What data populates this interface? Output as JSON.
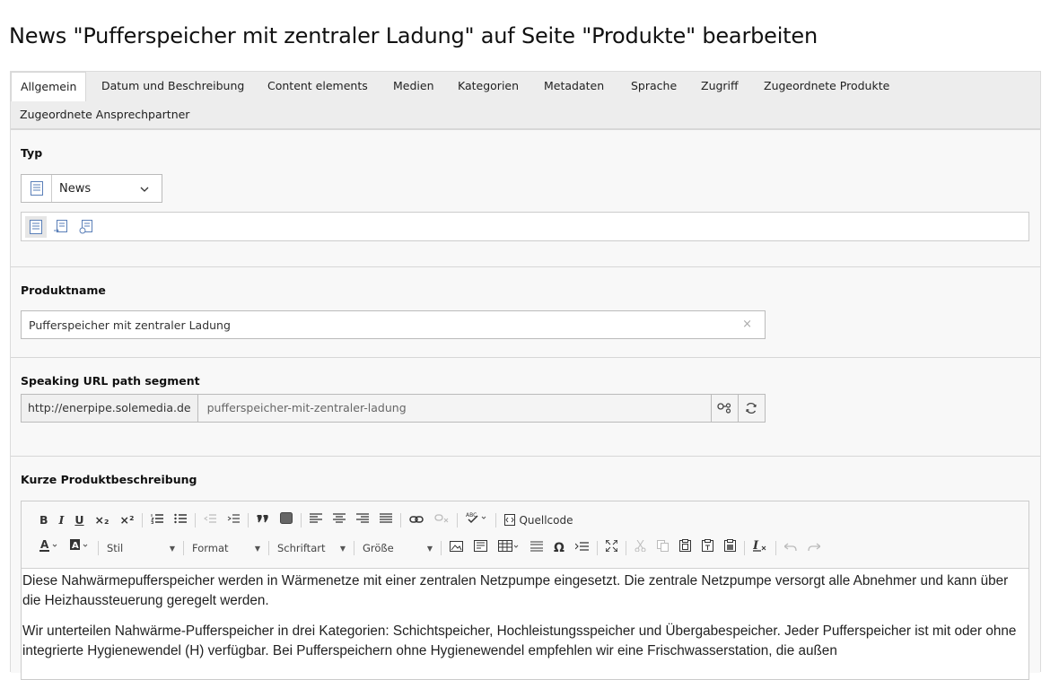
{
  "page_title": "News \"Pufferspeicher mit zentraler Ladung\" auf Seite \"Produkte\" bearbeiten",
  "tabs": [
    {
      "label": "Allgemein",
      "active": true
    },
    {
      "label": "Datum und Beschreibung"
    },
    {
      "label": "Content elements"
    },
    {
      "label": "Medien"
    },
    {
      "label": "Kategorien"
    },
    {
      "label": "Metadaten"
    },
    {
      "label": "Sprache"
    },
    {
      "label": "Zugriff"
    },
    {
      "label": "Zugeordnete Produkte"
    },
    {
      "label": "Zugeordnete Ansprechpartner"
    }
  ],
  "typ": {
    "label": "Typ",
    "selected": "News",
    "icons": [
      "news-type-icon",
      "internal-page-type-icon",
      "external-url-type-icon"
    ]
  },
  "produktname": {
    "label": "Produktname",
    "value": "Pufferspeicher mit zentraler Ladung",
    "clear_glyph": "×"
  },
  "url_segment": {
    "label": "Speaking URL path segment",
    "prefix": "http://enerpipe.solemedia.de",
    "value": "pufferspeicher-mit-zentraler-ladung"
  },
  "kurzbeschreibung": {
    "label": "Kurze Produktbeschreibung",
    "toolbar": {
      "row1": [
        "B",
        "I",
        "U",
        "×₂",
        "×²",
        "Quellcode"
      ],
      "row2_combos": [
        "Stil",
        "Format",
        "Schriftart",
        "Größe"
      ]
    },
    "paragraphs": [
      "Diese Nahwärmepufferspeicher werden in Wärmenetze mit einer zentralen Netzpumpe eingesetzt. Die zentrale Netzpumpe versorgt alle Abnehmer und kann über die Heizhaussteuerung geregelt werden.",
      "Wir unterteilen Nahwärme-Pufferspeicher in drei Kategorien: Schichtspeicher, Hochleistungsspeicher und Übergabespeicher. Jeder Pufferspeicher ist mit oder ohne integrierte Hygienewendel (H) verfügbar. Bei Pufferspeichern ohne Hygienewendel empfehlen wir eine Frischwasserstation, die außen"
    ]
  },
  "colors": {
    "tabbar_bg": "#ededed",
    "section_bg": "#f8f8f8",
    "border": "#d7d7d7"
  }
}
